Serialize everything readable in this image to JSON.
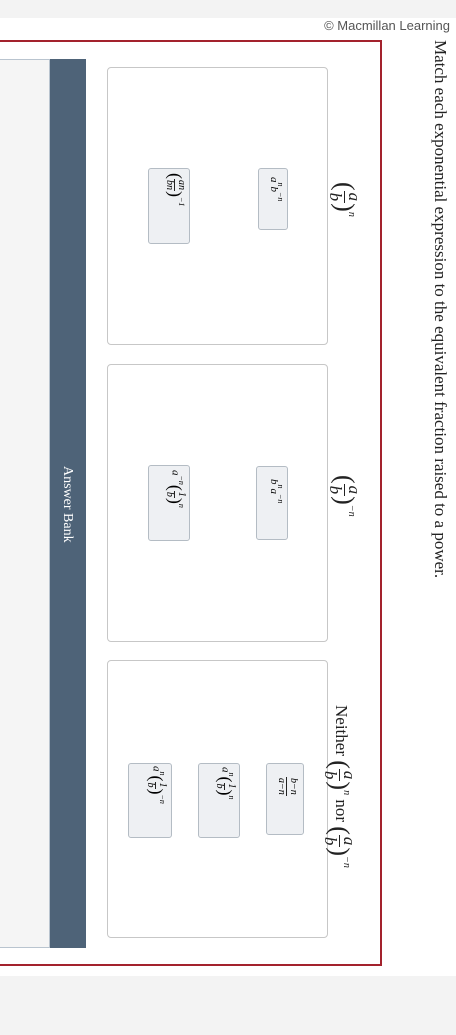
{
  "credit": "© Macmillan Learning",
  "instruction": "Match each exponential expression to the equivalent fraction raised to a power.",
  "answer_bank_label": "Answer Bank",
  "zones": [
    {
      "numerator": "a",
      "denominator": "b",
      "exponent": "n"
    },
    {
      "numerator": "a",
      "denominator": "b",
      "exponent": "−n"
    },
    {
      "prefix": "Neither",
      "connector": "nor",
      "first": {
        "numerator": "a",
        "denominator": "b",
        "exponent": "n"
      },
      "second": {
        "numerator": "a",
        "denominator": "b",
        "exponent": "−n"
      }
    }
  ],
  "tiles": {
    "z1_t1": {
      "base": "a",
      "exp1": "n",
      "base2": "b",
      "exp2": "−n"
    },
    "z1_t2": {
      "num": "a",
      "num_exp": "n",
      "den": "b",
      "den_exp": "n",
      "outer_exp": "−1"
    },
    "z2_t1": {
      "base": "b",
      "exp1": "n",
      "base2": "a",
      "exp2": "−n"
    },
    "z2_t2": {
      "prefix": "a",
      "prefix_exp": "−n",
      "num": "1",
      "den": "b",
      "outer_exp": "n"
    },
    "z3_t1": {
      "num": "b",
      "num_exp": "−n",
      "den": "a",
      "den_exp": "−n"
    },
    "z3_t2": {
      "prefix": "a",
      "prefix_exp": "n",
      "num": "1",
      "den": "b",
      "outer_exp": "n"
    },
    "z3_t3": {
      "prefix": "a",
      "prefix_exp": "n",
      "num": "1",
      "den": "b",
      "outer_exp": "−n"
    }
  }
}
